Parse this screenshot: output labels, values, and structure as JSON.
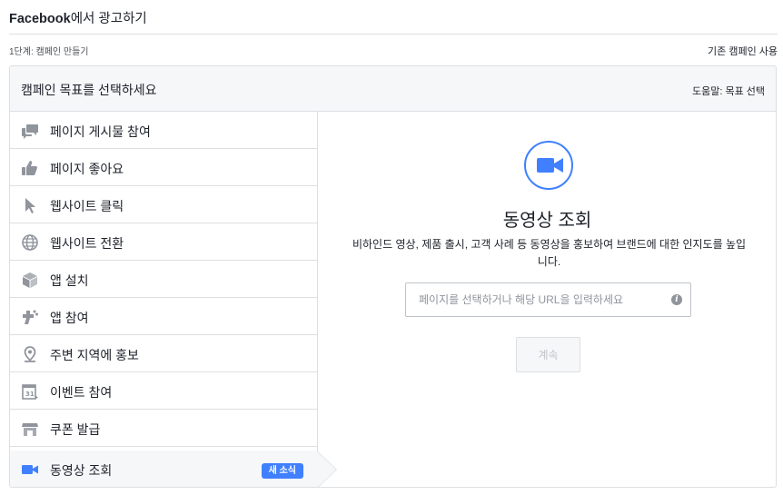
{
  "header": {
    "title_brand": "Facebook",
    "title_rest": "에서 광고하기"
  },
  "step": {
    "label": "1단계: 캠페인 만들기",
    "existing_link": "기존 캠페인 사용"
  },
  "panel": {
    "title": "캠페인 목표를 선택하세요",
    "help_link": "도움말: 목표 선택",
    "objectives": [
      {
        "label": "페이지 게시물 참여",
        "icon": "speech-bubbles-icon"
      },
      {
        "label": "페이지 좋아요",
        "icon": "thumbs-up-icon"
      },
      {
        "label": "웹사이트 클릭",
        "icon": "cursor-arrow-icon"
      },
      {
        "label": "웹사이트 전환",
        "icon": "globe-icon"
      },
      {
        "label": "앱 설치",
        "icon": "box-icon"
      },
      {
        "label": "앱 참여",
        "icon": "gamepad-icon"
      },
      {
        "label": "주변 지역에 홍보",
        "icon": "map-pin-icon"
      },
      {
        "label": "이벤트 참여",
        "icon": "calendar-icon"
      },
      {
        "label": "쿠폰 발급",
        "icon": "storefront-icon"
      },
      {
        "label": "동영상 조회",
        "icon": "video-camera-icon",
        "badge": "새 소식",
        "selected": true
      }
    ],
    "detail": {
      "title": "동영상 조회",
      "description": "비하인드 영상, 제품 출시, 고객 사례 등 동영상을 홍보하여 브랜드에 대한 인지도를 높입니다.",
      "input_placeholder": "페이지를 선택하거나 해당 URL을 입력하세요",
      "input_value": "",
      "info_icon": "i",
      "continue_label": "계속"
    }
  },
  "colors": {
    "accent": "#4080ff",
    "border": "#dddfe2",
    "header_bg": "#f6f7f9",
    "icon_gray": "#90949c",
    "text": "#1d2129"
  }
}
